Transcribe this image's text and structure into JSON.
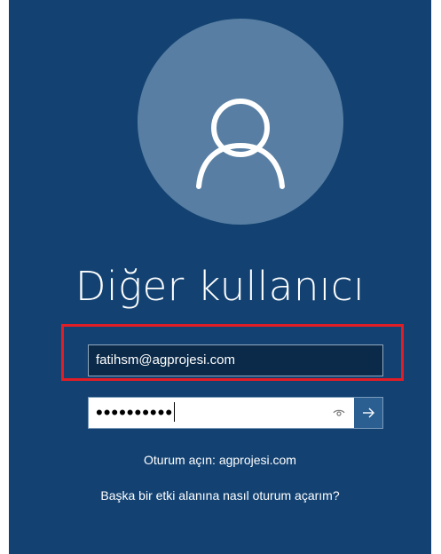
{
  "user": {
    "display_name": "Diğer kullanıcı",
    "icon": "user-icon"
  },
  "username_field": {
    "value": "fatihsm@agprojesi.com"
  },
  "password_field": {
    "masked_value": "••••••••••",
    "reveal_icon": "eye-icon",
    "submit_icon": "arrow-right-icon"
  },
  "signin_to": "Oturum açın: agprojesi.com",
  "other_domain_link": "Başka bir etki alanına nasıl oturum açarım?",
  "colors": {
    "background": "#134272",
    "avatar_circle": "#587fa3",
    "highlight_border": "#e11d25",
    "username_bg": "#0b2a49",
    "submit_bg": "#2b5f91"
  }
}
